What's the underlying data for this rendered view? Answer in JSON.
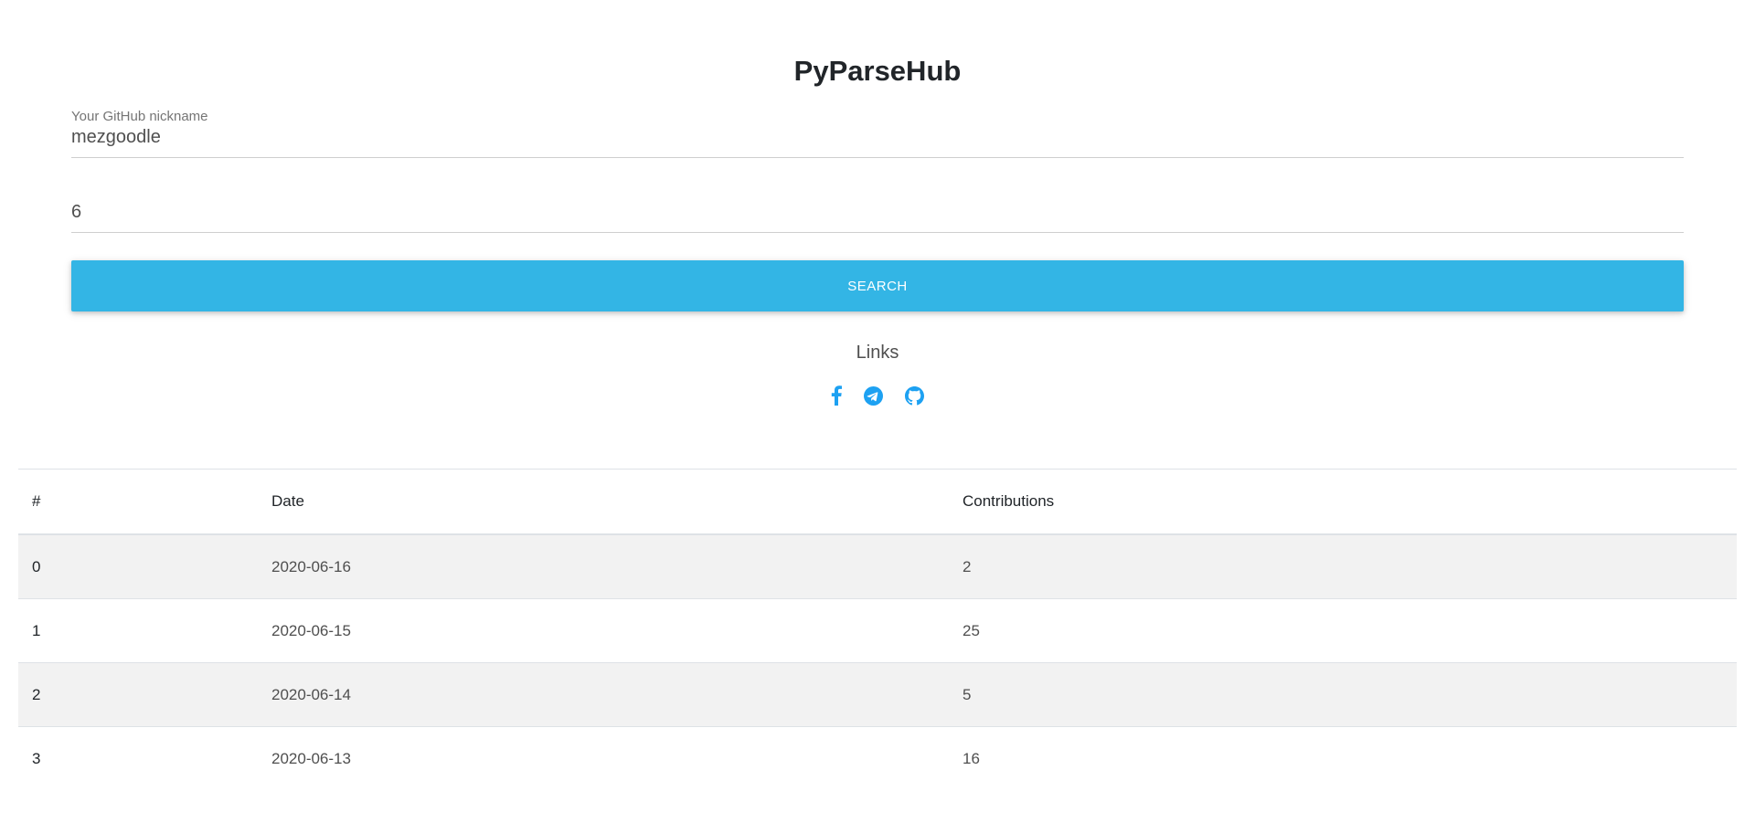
{
  "app": {
    "title": "PyParseHub"
  },
  "form": {
    "nickname_label": "Your GitHub nickname",
    "nickname_value": "mezgoodle",
    "count_value": "6",
    "search_label": "SEARCH"
  },
  "links": {
    "title": "Links",
    "icons": [
      "facebook-icon",
      "telegram-icon",
      "github-icon"
    ]
  },
  "colors": {
    "accent": "#33b5e5",
    "icon": "#1da1f2",
    "stripe": "#f2f2f2"
  },
  "table": {
    "headers": [
      "#",
      "Date",
      "Contributions"
    ],
    "rows": [
      [
        "0",
        "2020-06-16",
        "2"
      ],
      [
        "1",
        "2020-06-15",
        "25"
      ],
      [
        "2",
        "2020-06-14",
        "5"
      ],
      [
        "3",
        "2020-06-13",
        "16"
      ]
    ]
  }
}
